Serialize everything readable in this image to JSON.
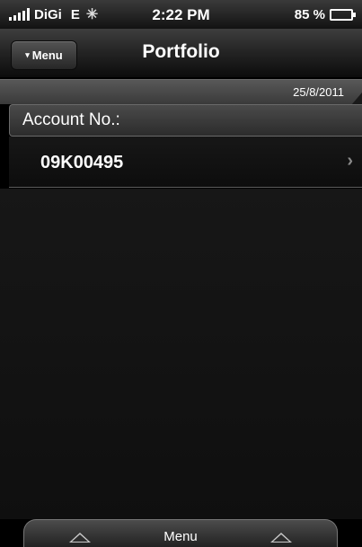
{
  "status_bar": {
    "carrier": "DiGi",
    "network": "E",
    "activity_glyph": "✳",
    "time": "2:22 PM",
    "battery_percent": "85 %",
    "battery_level": 0.85,
    "signal_icon": "signal-bars-icon",
    "battery_icon": "battery-icon"
  },
  "nav_bar": {
    "menu_caret": "▾",
    "menu_label": "Menu",
    "title": "Portfolio"
  },
  "date_strip": {
    "date": "25/8/2011"
  },
  "account_section": {
    "header": "Account No.:",
    "items": [
      {
        "number": "09K00495",
        "chevron": "›"
      }
    ]
  },
  "bottom_menu": {
    "label": "Menu"
  },
  "colors": {
    "background": "#000000",
    "bar_top": "#3e3e3e",
    "text": "#ffffff",
    "chevron": "#8a8a8a"
  }
}
